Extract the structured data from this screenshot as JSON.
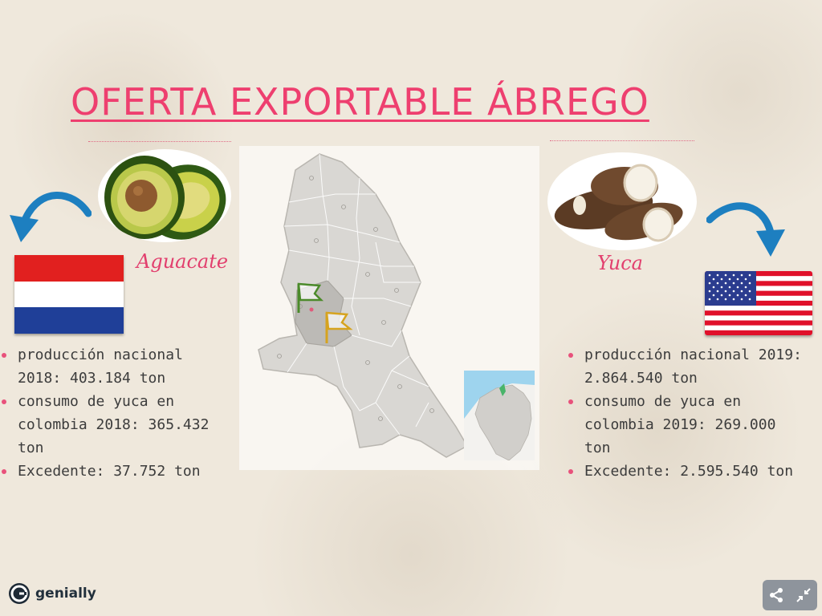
{
  "title": "OFERTA EXPORTABLE ÁBREGO",
  "left": {
    "product_label": "Aguacate",
    "image_icon": "avocado-image",
    "arrow_icon": "curved-arrow-left-icon",
    "flag_icon": "netherlands-flag",
    "facts": [
      "producción nacional 2018: 403.184 ton",
      "consumo de yuca en colombia 2018: 365.432 ton",
      "Excedente: 37.752  ton"
    ]
  },
  "right": {
    "product_label": "Yuca",
    "image_icon": "cassava-image",
    "arrow_icon": "curved-arrow-right-icon",
    "flag_icon": "usa-flag",
    "facts": [
      "producción nacional 2019: 2.864.540 ton",
      "consumo de yuca en colombia 2019: 269.000 ton",
      "Excedente: 2.595.540 ton"
    ]
  },
  "map": {
    "icon": "norte-de-santander-map",
    "inset_icon": "colombia-inset-map"
  },
  "footer": {
    "brand_name": "genially",
    "share_icon": "share-icon",
    "collapse_icon": "collapse-icon"
  },
  "colors": {
    "accent": "#ee3f6f",
    "arrow": "#1d7fc0",
    "text": "#3c3c3c"
  }
}
